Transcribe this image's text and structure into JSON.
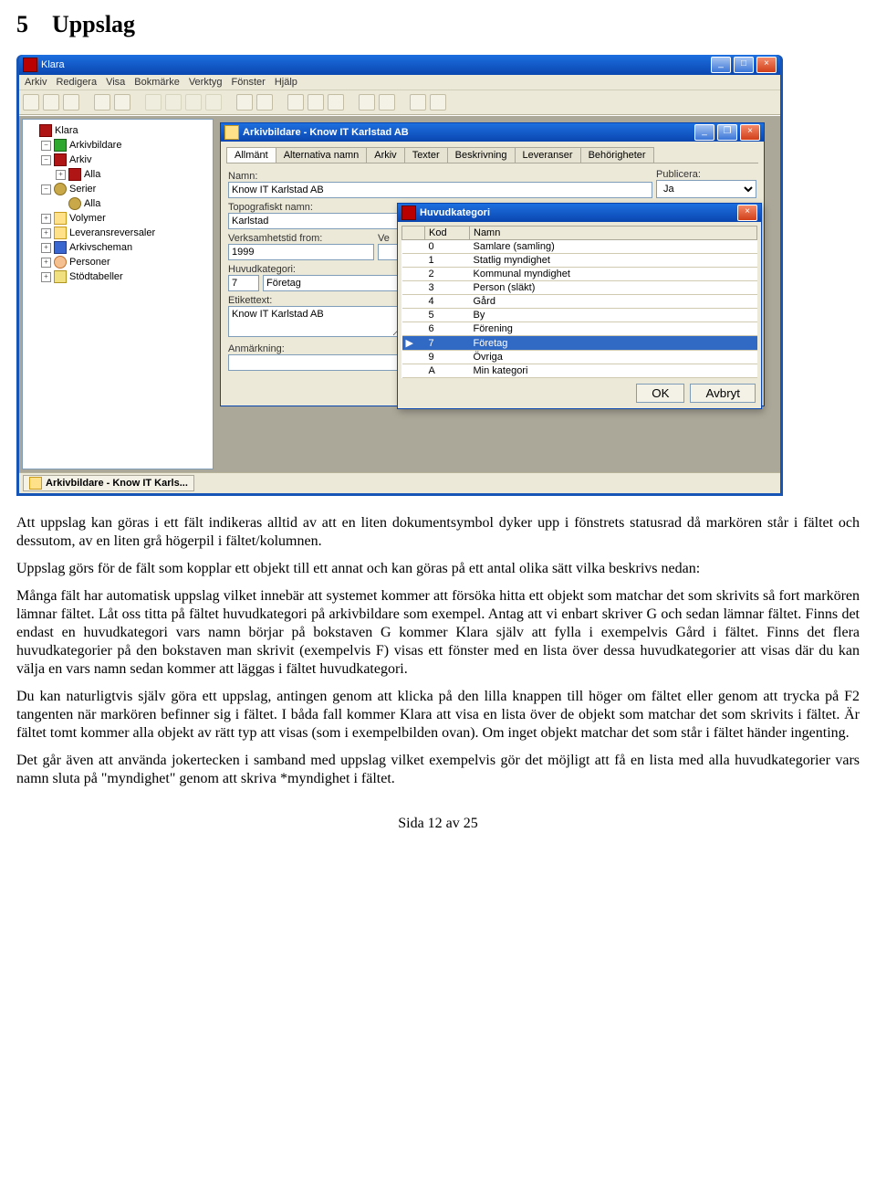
{
  "heading_number": "5",
  "heading_text": "Uppslag",
  "main_window": {
    "title": "Klara",
    "menu": [
      "Arkiv",
      "Redigera",
      "Visa",
      "Bokmärke",
      "Verktyg",
      "Fönster",
      "Hjälp"
    ]
  },
  "tree": [
    {
      "icon": "ti-red",
      "label": "Klara",
      "toggle": ""
    },
    {
      "icon": "ti-green",
      "label": "Arkivbildare",
      "toggle": "−",
      "indent": 1
    },
    {
      "icon": "ti-red",
      "label": "Arkiv",
      "toggle": "−",
      "indent": 1
    },
    {
      "icon": "ti-red",
      "label": "Alla",
      "toggle": "+",
      "indent": 2
    },
    {
      "icon": "ti-barrel",
      "label": "Serier",
      "toggle": "−",
      "indent": 1
    },
    {
      "icon": "ti-barrel",
      "label": "Alla",
      "toggle": "",
      "indent": 2
    },
    {
      "icon": "ti-box",
      "label": "Volymer",
      "toggle": "+",
      "indent": 1
    },
    {
      "icon": "ti-box",
      "label": "Leveransreversaler",
      "toggle": "+",
      "indent": 1
    },
    {
      "icon": "ti-cube",
      "label": "Arkivscheman",
      "toggle": "+",
      "indent": 1
    },
    {
      "icon": "ti-person",
      "label": "Personer",
      "toggle": "+",
      "indent": 1
    },
    {
      "icon": "ti-table",
      "label": "Stödtabeller",
      "toggle": "+",
      "indent": 1
    }
  ],
  "child_window": {
    "title": "Arkivbildare - Know IT Karlstad AB",
    "tabs": [
      "Allmänt",
      "Alternativa namn",
      "Arkiv",
      "Texter",
      "Beskrivning",
      "Leveranser",
      "Behörigheter"
    ],
    "fields": {
      "namn_label": "Namn:",
      "namn_value": "Know IT Karlstad AB",
      "publicera_label": "Publicera:",
      "publicera_value": "Ja",
      "topo_label": "Topografiskt namn:",
      "topo_value": "Karlstad",
      "verk_from_label": "Verksamhetstid from:",
      "verk_from_value": "1999",
      "verk_tom_label": "Ve",
      "huvud_label": "Huvudkategori:",
      "huvud_code": "7",
      "huvud_name": "Företag",
      "etikett_label": "Etikettext:",
      "etikett_value": "Know IT Karlstad AB",
      "anm_label": "Anmärkning:"
    }
  },
  "popup": {
    "title": "Huvudkategori",
    "col_kod": "Kod",
    "col_namn": "Namn",
    "rows": [
      {
        "kod": "0",
        "namn": "Samlare (samling)"
      },
      {
        "kod": "1",
        "namn": "Statlig myndighet"
      },
      {
        "kod": "2",
        "namn": "Kommunal myndighet"
      },
      {
        "kod": "3",
        "namn": "Person (släkt)"
      },
      {
        "kod": "4",
        "namn": "Gård"
      },
      {
        "kod": "5",
        "namn": "By"
      },
      {
        "kod": "6",
        "namn": "Förening"
      },
      {
        "kod": "7",
        "namn": "Företag",
        "selected": true
      },
      {
        "kod": "9",
        "namn": "Övriga"
      },
      {
        "kod": "A",
        "namn": "Min kategori"
      }
    ],
    "ok_label": "OK",
    "cancel_label": "Avbryt"
  },
  "statusbar_task": "Arkivbildare - Know IT Karls...",
  "paragraphs": [
    "Att uppslag kan göras i ett fält indikeras alltid av att en liten dokumentsymbol dyker upp i fönstrets statusrad då markören står i fältet och dessutom, av en liten grå högerpil i fältet/kolumnen.",
    "Uppslag görs för de fält som kopplar ett objekt till ett annat och kan göras på ett antal olika sätt vilka beskrivs nedan:",
    "Många fält har automatisk uppslag vilket innebär att systemet kommer att försöka hitta ett objekt som matchar det som skrivits så fort markören lämnar fältet. Låt oss titta på fältet huvudkategori på arkivbildare som exempel. Antag att vi enbart skriver G och sedan lämnar fältet. Finns det endast en huvudkategori  vars namn börjar på bokstaven G kommer Klara själv att fylla i exempelvis Gård i fältet. Finns det flera huvudkategorier på den bokstaven man skrivit (exempelvis F) visas ett fönster med en lista över dessa huvudkategorier att visas där du kan välja en vars namn sedan kommer att läggas i fältet huvudkategori.",
    "Du kan naturligtvis själv göra ett uppslag, antingen genom att klicka  på den lilla knappen till höger om fältet eller genom att trycka på F2 tangenten när markören befinner sig i fältet. I båda fall kommer Klara att visa en lista över de objekt som matchar det som skrivits i fältet. Är fältet tomt kommer alla objekt av rätt typ att visas (som i exempelbilden ovan). Om inget objekt matchar det som står i fältet händer ingenting.",
    "Det går även att använda jokertecken i samband med uppslag vilket exempelvis gör det möjligt att få en lista med alla huvudkategorier vars namn sluta på \"myndighet\" genom att skriva *myndighet i fältet."
  ],
  "footer": "Sida 12 av 25"
}
